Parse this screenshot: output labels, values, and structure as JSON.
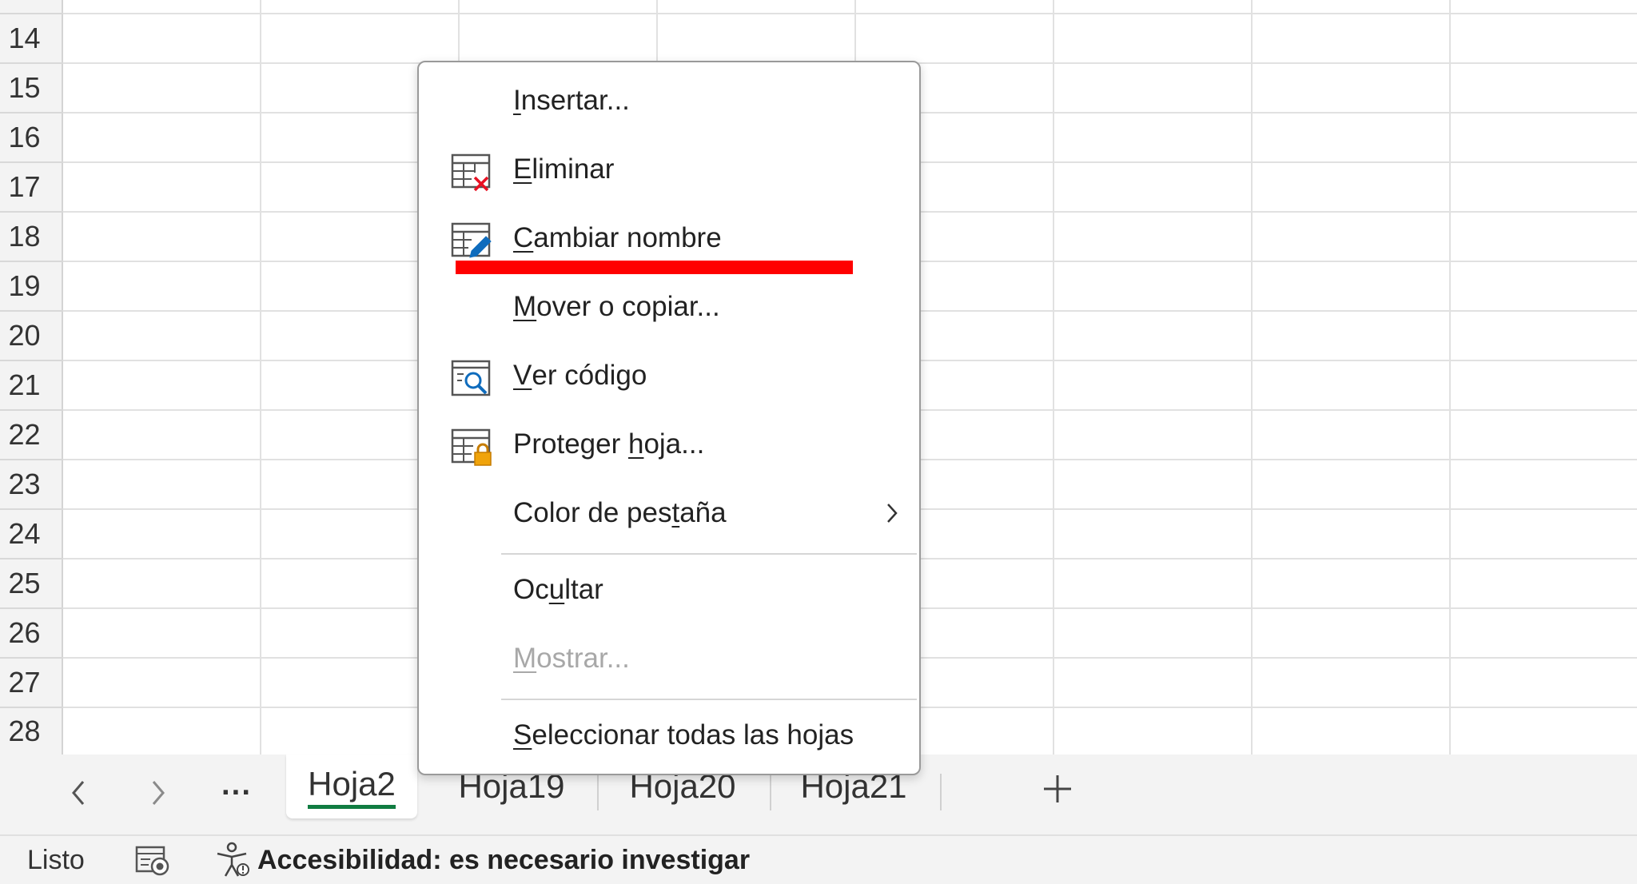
{
  "app": {
    "accent_color": "#107c41",
    "annotation_color": "#ff0000"
  },
  "grid": {
    "rows": [
      "14",
      "15",
      "16",
      "17",
      "18",
      "19",
      "20",
      "21",
      "22",
      "23",
      "24",
      "25",
      "26",
      "27",
      "28"
    ]
  },
  "context_menu": {
    "items": [
      {
        "label": "Insertar...",
        "mnemonic": "I",
        "icon": "none",
        "disabled": false
      },
      {
        "label": "Eliminar",
        "mnemonic": "E",
        "icon": "delete-sheet-icon",
        "disabled": false
      },
      {
        "label": "Cambiar nombre",
        "mnemonic": "C",
        "icon": "rename-sheet-icon",
        "disabled": false,
        "annotated": true
      },
      {
        "label": "Mover o copiar...",
        "mnemonic": "M",
        "icon": "none",
        "disabled": false
      },
      {
        "label": "Ver código",
        "mnemonic": "V",
        "icon": "view-code-icon",
        "disabled": false
      },
      {
        "label": "Proteger hoja...",
        "mnemonic": "h",
        "icon": "protect-sheet-icon",
        "disabled": false
      },
      {
        "label": "Color de pestaña",
        "mnemonic": "t",
        "icon": "none",
        "disabled": false,
        "submenu": true
      },
      {
        "label": "Ocultar",
        "mnemonic": "u",
        "icon": "none",
        "disabled": false
      },
      {
        "label": "Mostrar...",
        "mnemonic": "M",
        "icon": "none",
        "disabled": true
      },
      {
        "label": "Seleccionar todas las hojas",
        "mnemonic": "S",
        "icon": "none",
        "disabled": false
      }
    ]
  },
  "tabs": {
    "more_label": "···",
    "sheets": [
      {
        "name": "Hoja2",
        "active": true
      },
      {
        "name": "Hoja19",
        "active": false
      },
      {
        "name": "Hoja20",
        "active": false
      },
      {
        "name": "Hoja21",
        "active": false
      }
    ]
  },
  "status": {
    "ready": "Listo",
    "accessibility": "Accesibilidad: es necesario investigar"
  }
}
